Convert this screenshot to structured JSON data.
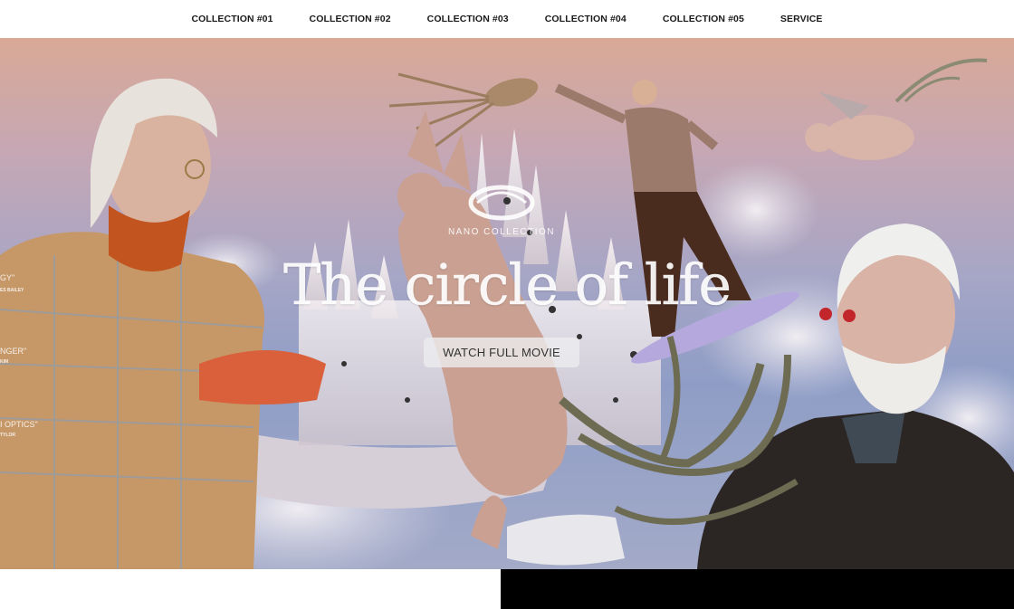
{
  "nav": {
    "items": [
      {
        "label": "COLLECTION #01"
      },
      {
        "label": "COLLECTION #02"
      },
      {
        "label": "COLLECTION #03"
      },
      {
        "label": "COLLECTION #04"
      },
      {
        "label": "COLLECTION #05"
      },
      {
        "label": "SERVICE"
      }
    ]
  },
  "hero": {
    "brand_sub": "NANO COLLECTION",
    "title": "The circle of life",
    "cta": "WATCH FULL MOVIE",
    "credits": [
      {
        "title": "GY\"",
        "sub": "ES BAILEY"
      },
      {
        "title": "NGER\"",
        "sub": "KIM"
      },
      {
        "title": "I OPTICS\"",
        "sub": "TYLOR"
      }
    ]
  },
  "colors": {
    "sky_top": "#d9a996",
    "sky_bottom": "#8f9dc6",
    "button_bg": "#ebebee",
    "block": "#000000"
  }
}
